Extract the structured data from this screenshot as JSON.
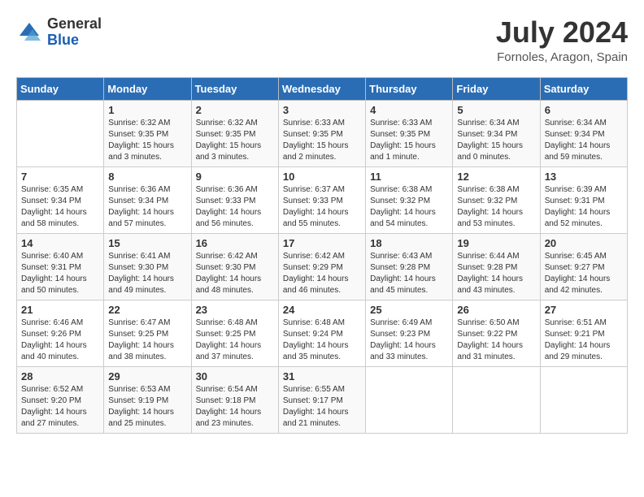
{
  "header": {
    "logo_general": "General",
    "logo_blue": "Blue",
    "title": "July 2024",
    "location": "Fornoles, Aragon, Spain"
  },
  "days_of_week": [
    "Sunday",
    "Monday",
    "Tuesday",
    "Wednesday",
    "Thursday",
    "Friday",
    "Saturday"
  ],
  "weeks": [
    [
      {
        "day": "",
        "info": ""
      },
      {
        "day": "1",
        "info": "Sunrise: 6:32 AM\nSunset: 9:35 PM\nDaylight: 15 hours\nand 3 minutes."
      },
      {
        "day": "2",
        "info": "Sunrise: 6:32 AM\nSunset: 9:35 PM\nDaylight: 15 hours\nand 3 minutes."
      },
      {
        "day": "3",
        "info": "Sunrise: 6:33 AM\nSunset: 9:35 PM\nDaylight: 15 hours\nand 2 minutes."
      },
      {
        "day": "4",
        "info": "Sunrise: 6:33 AM\nSunset: 9:35 PM\nDaylight: 15 hours\nand 1 minute."
      },
      {
        "day": "5",
        "info": "Sunrise: 6:34 AM\nSunset: 9:34 PM\nDaylight: 15 hours\nand 0 minutes."
      },
      {
        "day": "6",
        "info": "Sunrise: 6:34 AM\nSunset: 9:34 PM\nDaylight: 14 hours\nand 59 minutes."
      }
    ],
    [
      {
        "day": "7",
        "info": "Sunrise: 6:35 AM\nSunset: 9:34 PM\nDaylight: 14 hours\nand 58 minutes."
      },
      {
        "day": "8",
        "info": "Sunrise: 6:36 AM\nSunset: 9:34 PM\nDaylight: 14 hours\nand 57 minutes."
      },
      {
        "day": "9",
        "info": "Sunrise: 6:36 AM\nSunset: 9:33 PM\nDaylight: 14 hours\nand 56 minutes."
      },
      {
        "day": "10",
        "info": "Sunrise: 6:37 AM\nSunset: 9:33 PM\nDaylight: 14 hours\nand 55 minutes."
      },
      {
        "day": "11",
        "info": "Sunrise: 6:38 AM\nSunset: 9:32 PM\nDaylight: 14 hours\nand 54 minutes."
      },
      {
        "day": "12",
        "info": "Sunrise: 6:38 AM\nSunset: 9:32 PM\nDaylight: 14 hours\nand 53 minutes."
      },
      {
        "day": "13",
        "info": "Sunrise: 6:39 AM\nSunset: 9:31 PM\nDaylight: 14 hours\nand 52 minutes."
      }
    ],
    [
      {
        "day": "14",
        "info": "Sunrise: 6:40 AM\nSunset: 9:31 PM\nDaylight: 14 hours\nand 50 minutes."
      },
      {
        "day": "15",
        "info": "Sunrise: 6:41 AM\nSunset: 9:30 PM\nDaylight: 14 hours\nand 49 minutes."
      },
      {
        "day": "16",
        "info": "Sunrise: 6:42 AM\nSunset: 9:30 PM\nDaylight: 14 hours\nand 48 minutes."
      },
      {
        "day": "17",
        "info": "Sunrise: 6:42 AM\nSunset: 9:29 PM\nDaylight: 14 hours\nand 46 minutes."
      },
      {
        "day": "18",
        "info": "Sunrise: 6:43 AM\nSunset: 9:28 PM\nDaylight: 14 hours\nand 45 minutes."
      },
      {
        "day": "19",
        "info": "Sunrise: 6:44 AM\nSunset: 9:28 PM\nDaylight: 14 hours\nand 43 minutes."
      },
      {
        "day": "20",
        "info": "Sunrise: 6:45 AM\nSunset: 9:27 PM\nDaylight: 14 hours\nand 42 minutes."
      }
    ],
    [
      {
        "day": "21",
        "info": "Sunrise: 6:46 AM\nSunset: 9:26 PM\nDaylight: 14 hours\nand 40 minutes."
      },
      {
        "day": "22",
        "info": "Sunrise: 6:47 AM\nSunset: 9:25 PM\nDaylight: 14 hours\nand 38 minutes."
      },
      {
        "day": "23",
        "info": "Sunrise: 6:48 AM\nSunset: 9:25 PM\nDaylight: 14 hours\nand 37 minutes."
      },
      {
        "day": "24",
        "info": "Sunrise: 6:48 AM\nSunset: 9:24 PM\nDaylight: 14 hours\nand 35 minutes."
      },
      {
        "day": "25",
        "info": "Sunrise: 6:49 AM\nSunset: 9:23 PM\nDaylight: 14 hours\nand 33 minutes."
      },
      {
        "day": "26",
        "info": "Sunrise: 6:50 AM\nSunset: 9:22 PM\nDaylight: 14 hours\nand 31 minutes."
      },
      {
        "day": "27",
        "info": "Sunrise: 6:51 AM\nSunset: 9:21 PM\nDaylight: 14 hours\nand 29 minutes."
      }
    ],
    [
      {
        "day": "28",
        "info": "Sunrise: 6:52 AM\nSunset: 9:20 PM\nDaylight: 14 hours\nand 27 minutes."
      },
      {
        "day": "29",
        "info": "Sunrise: 6:53 AM\nSunset: 9:19 PM\nDaylight: 14 hours\nand 25 minutes."
      },
      {
        "day": "30",
        "info": "Sunrise: 6:54 AM\nSunset: 9:18 PM\nDaylight: 14 hours\nand 23 minutes."
      },
      {
        "day": "31",
        "info": "Sunrise: 6:55 AM\nSunset: 9:17 PM\nDaylight: 14 hours\nand 21 minutes."
      },
      {
        "day": "",
        "info": ""
      },
      {
        "day": "",
        "info": ""
      },
      {
        "day": "",
        "info": ""
      }
    ]
  ]
}
